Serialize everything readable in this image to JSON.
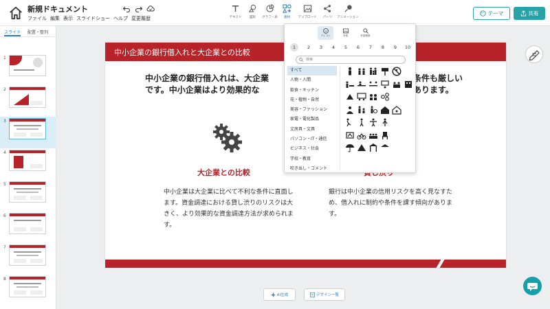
{
  "app": {
    "doc_title": "新規ドキュメント",
    "menus": [
      "ファイル",
      "編集",
      "表示",
      "スライドショー",
      "ヘルプ",
      "変更履歴"
    ]
  },
  "toolbar": {
    "tools": [
      {
        "label": "テキスト",
        "icon": "text-icon"
      },
      {
        "label": "図形",
        "icon": "shape-icon"
      },
      {
        "label": "グラフ・表",
        "icon": "chart-icon"
      },
      {
        "label": "素材",
        "icon": "material-icon",
        "active": true
      },
      {
        "label": "アップロード",
        "icon": "upload-icon"
      },
      {
        "label": "パーツ",
        "icon": "parts-icon"
      },
      {
        "label": "アニメーション",
        "icon": "animation-icon"
      }
    ],
    "theme_label": "テーマ",
    "share_label": "共有"
  },
  "left_panel": {
    "tabs": [
      "スライド",
      "配置・整列"
    ],
    "slides": [
      "1",
      "2",
      "3",
      "4",
      "5",
      "6",
      "7",
      "8"
    ],
    "selected": 3
  },
  "slide": {
    "header": "中小企業の銀行借入れと大企業との比較",
    "lead_left": "中小企業の銀行借入れは、大企業",
    "lead_left2": "です。中小企業はより効果的な",
    "lead_right": "条件も厳しい",
    "lead_right2": "あります。",
    "col_left_title": "大企業との比較",
    "col_right_title": "貸し渋り",
    "col_left_text": "中小企業は大企業に比べて不利な条件に直面します。資金調達における貸し渋りのリスクは大きく、より効果的な資金調達方法が求められます。",
    "col_right_text": "銀行は中小企業の信用リスクを高く見なすため、借入れに制約や条件を課す傾向があります。"
  },
  "material_popup": {
    "tabs": [
      "アイコン",
      "写真",
      "外部検索"
    ],
    "pages": [
      "1",
      "2",
      "3",
      "4",
      "5",
      "6",
      "7",
      "8",
      "9",
      "10"
    ],
    "search_placeholder": "検索",
    "categories": [
      "すべて",
      "人物・人間",
      "飲食・キッチン",
      "花・植物・自然",
      "美容・ファッション",
      "家電・電化製品",
      "文房具・文具",
      "パソコン・IT・通信",
      "ビジネス・社会",
      "学校・教育",
      "吹き出し・コメント"
    ]
  },
  "bottom": {
    "ai_label": "AI生成",
    "design_label": "デザイン一覧"
  },
  "colors": {
    "accent": "#2aa3a8",
    "slide_red": "#b8232a",
    "link_blue": "#2a7fb8"
  }
}
